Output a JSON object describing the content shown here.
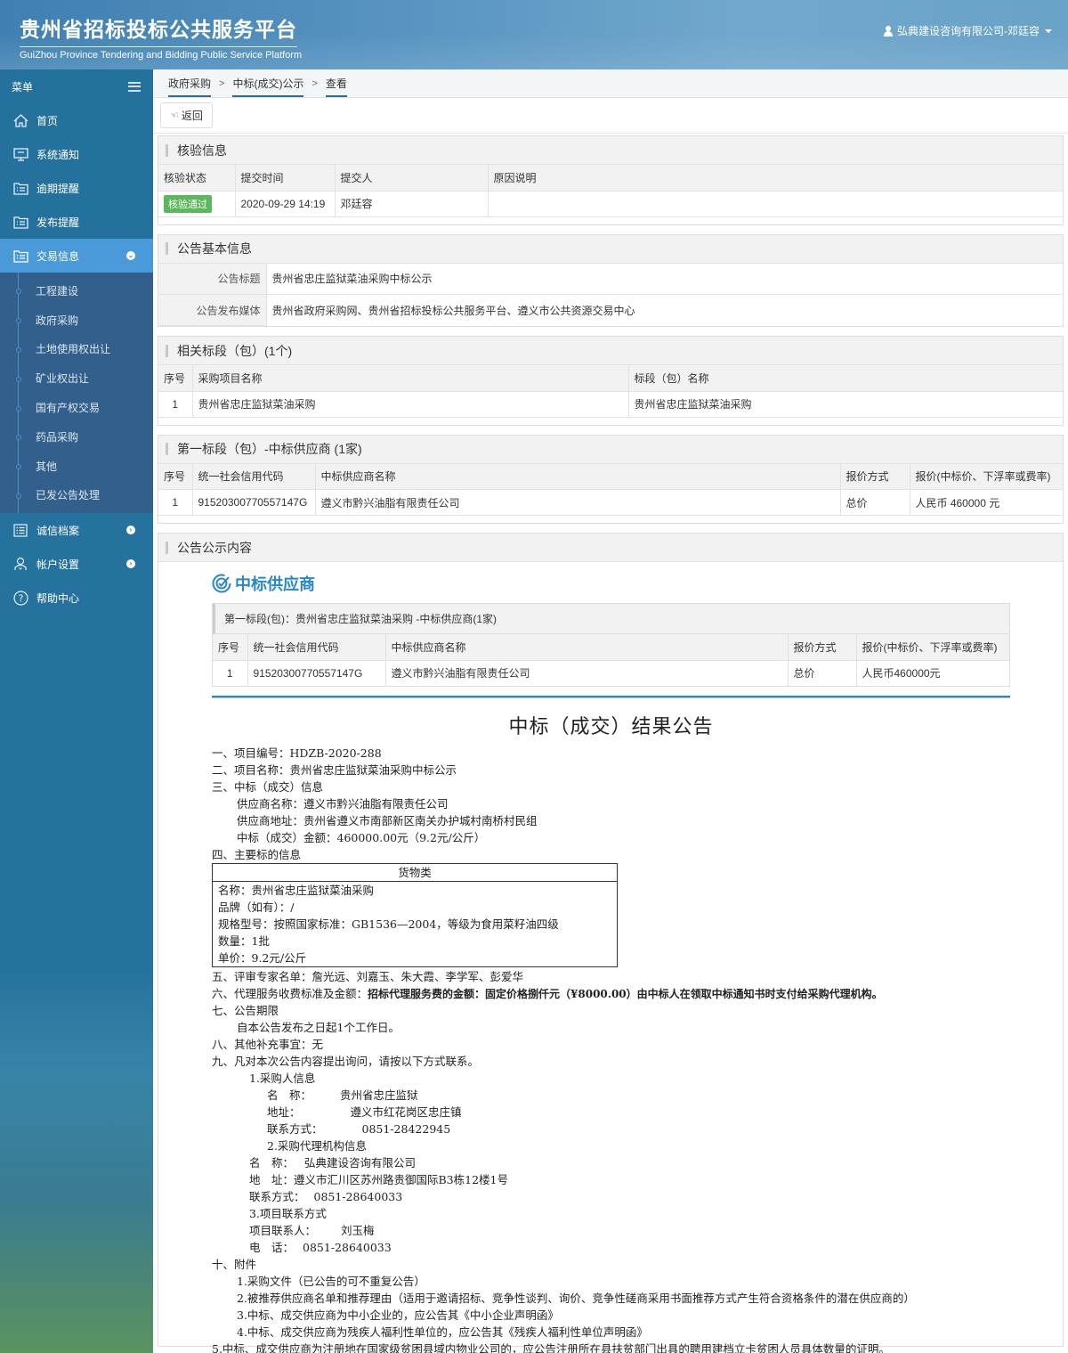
{
  "header": {
    "title": "贵州省招标投标公共服务平台",
    "subtitle": "GuiZhou Province Tendering and Bidding Public Service Platform",
    "user": "弘典建设咨询有限公司-邓廷容"
  },
  "sidebar": {
    "menu_label": "菜单",
    "items": [
      {
        "label": "首页",
        "icon": "home-icon"
      },
      {
        "label": "系统通知",
        "icon": "monitor-icon"
      },
      {
        "label": "逾期提醒",
        "icon": "folder-list-icon"
      },
      {
        "label": "发布提醒",
        "icon": "folder-list-icon"
      },
      {
        "label": "交易信息",
        "icon": "folder-list-icon",
        "active": true,
        "expanded": true
      }
    ],
    "subitems": [
      "工程建设",
      "政府采购",
      "土地使用权出让",
      "矿业权出让",
      "国有产权交易",
      "药品采购",
      "其他",
      "已发公告处理"
    ],
    "bottom_items": [
      {
        "label": "诚信档案",
        "icon": "list-icon"
      },
      {
        "label": "帐户设置",
        "icon": "user-settings-icon"
      },
      {
        "label": "帮助中心",
        "icon": "help-icon"
      }
    ]
  },
  "breadcrumb": [
    "政府采购",
    "中标(成交)公示",
    "查看"
  ],
  "toolbar": {
    "back_label": "返回"
  },
  "verify": {
    "title": "核验信息",
    "columns": [
      "核验状态",
      "提交时间",
      "提交人",
      "原因说明"
    ],
    "row": {
      "status": "核验通过",
      "time": "2020-09-29 14:19",
      "submitter": "邓廷容",
      "reason": ""
    },
    "status_color": "#5cb85c"
  },
  "basic": {
    "title": "公告基本信息",
    "rows": [
      {
        "key": "公告标题",
        "value": "贵州省忠庄监狱菜油采购中标公示"
      },
      {
        "key": "公告发布媒体",
        "value": "贵州省政府采购网、贵州省招标投标公共服务平台、遵义市公共资源交易中心"
      }
    ]
  },
  "sections": {
    "title": "相关标段（包）(1个)",
    "columns": [
      "序号",
      "采购项目名称",
      "标段（包）名称"
    ],
    "rows": [
      {
        "no": "1",
        "project": "贵州省忠庄监狱菜油采购",
        "section": "贵州省忠庄监狱菜油采购"
      }
    ]
  },
  "winners": {
    "title": "第一标段（包）-中标供应商 (1家)",
    "columns": [
      "序号",
      "统一社会信用代码",
      "中标供应商名称",
      "报价方式",
      "报价(中标价、下浮率或费率)"
    ],
    "rows": [
      {
        "no": "1",
        "code": "91520300770557147G",
        "name": "遵义市黔兴油脂有限责任公司",
        "method": "总价",
        "price": "人民币 460000 元"
      }
    ]
  },
  "notice": {
    "title": "公告公示内容",
    "win_heading": "中标供应商",
    "win_box_title": "第一标段(包)：贵州省忠庄监狱菜油采购 -中标供应商(1家)",
    "columns": [
      "序号",
      "统一社会信用代码",
      "中标供应商名称",
      "报价方式",
      "报价(中标价、下浮率或费率)"
    ],
    "rows": [
      {
        "no": "1",
        "code": "91520300770557147G",
        "name": "遵义市黔兴油脂有限责任公司",
        "method": "总价",
        "price": "人民币460000元"
      }
    ],
    "doc_title": "中标（成交）结果公告",
    "lines": {
      "l1": "一、项目编号：HDZB-2020-288",
      "l2": "二、项目名称：贵州省忠庄监狱菜油采购中标公示",
      "l3": "三、中标（成交）信息",
      "l3a": "供应商名称：遵义市黔兴油脂有限责任公司",
      "l3b": "供应商地址：贵州省遵义市南部新区南关办护城村南桥村民组",
      "l3c": "中标（成交）金额：460000.00元（9.2元/公斤）",
      "l4": "四、主要标的信息",
      "goods_head": "货物类",
      "goods": [
        "名称：贵州省忠庄监狱菜油采购",
        "品牌（如有）：/",
        "规格型号：按照国家标准：GB1536—2004，等级为食用菜籽油四级",
        "数量：1批",
        "单价：9.2元/公斤"
      ],
      "l5": "五、评审专家名单：詹光远、刘嘉玉、朱大霞、李学军、彭爱华",
      "l6_prefix": "六、代理服务收费标准及金额：",
      "l6_bold": "招标代理服务费的金额：固定价格捌仟元（¥8000.00）由中标人在领取中标通知书时支付给采购代理机构。",
      "l7": "七、公告期限",
      "l7a": "自本公告发布之日起1个工作日。",
      "l8": "八、其他补充事宜：无",
      "l9": "九、凡对本次公告内容提出询问，请按以下方式联系。",
      "c1": "1.采购人信息",
      "c1a_k": "名　称：",
      "c1a_v": "贵州省忠庄监狱",
      "c1b_k": "地址：",
      "c1b_v": "遵义市红花岗区忠庄镇",
      "c1c_k": "联系方式：",
      "c1c_v": "0851-28422945",
      "c2": "2.采购代理机构信息",
      "c2a_k": "名　称：",
      "c2a_v": "弘典建设咨询有限公司",
      "c2b": "地　址：遵义市汇川区苏州路贵御国际B3栋12楼1号",
      "c2c_k": "联系方式：",
      "c2c_v": "0851-28640033",
      "c3": "3.项目联系方式",
      "c3a_k": "项目联系人：",
      "c3a_v": "刘玉梅",
      "c3b_k": "电　话：",
      "c3b_v": "0851-28640033",
      "l10": "十、附件",
      "a1": "1.采购文件（已公告的可不重复公告）",
      "a2": "2.被推荐供应商名单和推荐理由（适用于邀请招标、竞争性谈判、询价、竞争性磋商采用书面推荐方式产生符合资格条件的潜在供应商的）",
      "a3": "3.中标、成交供应商为中小企业的，应公告其《中小企业声明函》",
      "a4": "4.中标、成交供应商为残疾人福利性单位的，应公告其《残疾人福利性单位声明函》",
      "a5": "5.中标、成交供应商为注册地在国家级贫困县域内物业公司的，应公告注册所在县扶贫部门出具的聘用建档立卡贫困人员具体数量的证明。"
    }
  },
  "colors": {
    "sidebar_bg": "#25719e",
    "sidebar_active": "#4a9ad9",
    "submenu_bg": "#325f8c",
    "accent_blue": "#2a86c4",
    "success_green": "#5cb85c"
  }
}
